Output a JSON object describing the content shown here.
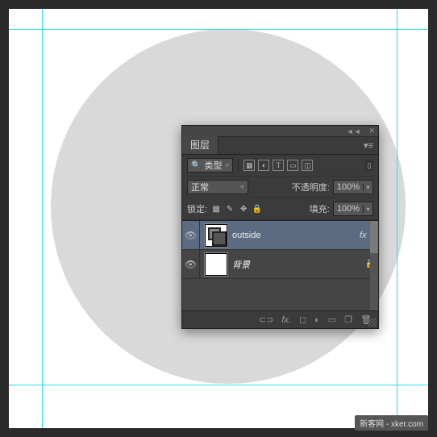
{
  "panel": {
    "title": "图层",
    "filter_label": "类型",
    "blend_mode": "正常",
    "opacity_label": "不透明度:",
    "opacity_value": "100%",
    "lock_label": "锁定:",
    "fill_label": "填充:",
    "fill_value": "100%"
  },
  "layers": [
    {
      "name": "outside",
      "selected": true,
      "fx": "fx",
      "locked": false,
      "italic": false
    },
    {
      "name": "背景",
      "selected": false,
      "fx": "",
      "locked": true,
      "italic": true
    }
  ],
  "watermark": "新客网 - xker.com"
}
